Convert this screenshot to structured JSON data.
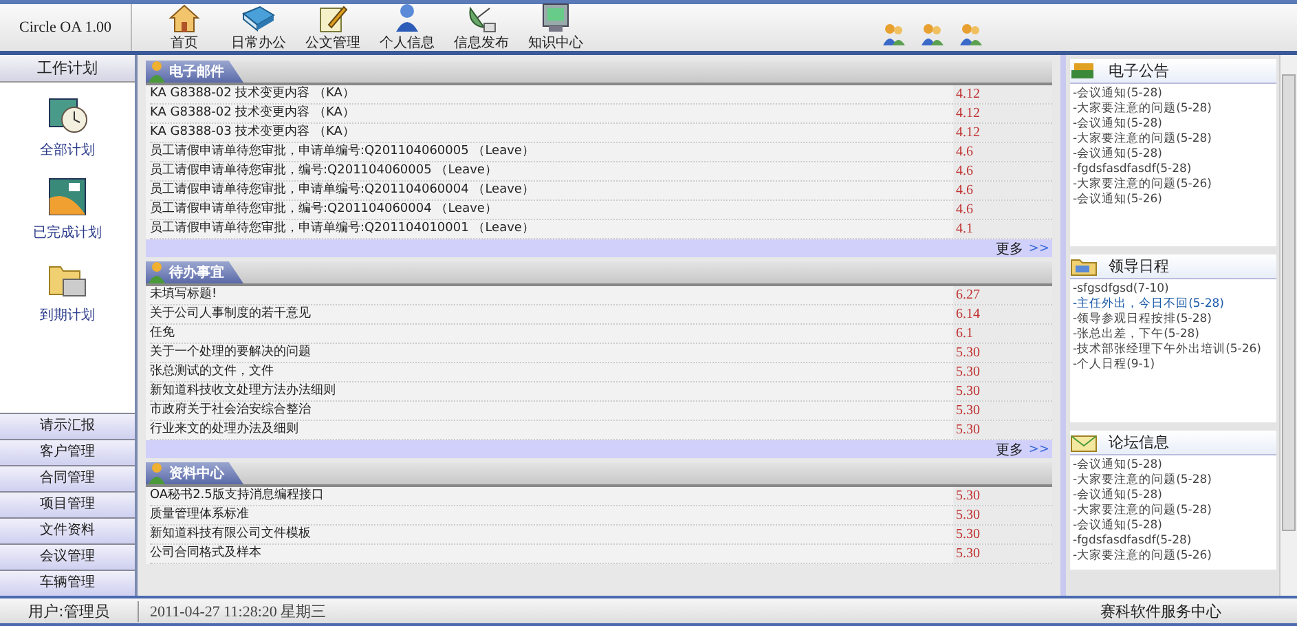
{
  "app_title": "Circle OA 1.00",
  "nav": [
    {
      "label": "首页"
    },
    {
      "label": "日常办公"
    },
    {
      "label": "公文管理"
    },
    {
      "label": "个人信息"
    },
    {
      "label": "信息发布"
    },
    {
      "label": "知识中心"
    }
  ],
  "sidebar": {
    "header": "工作计划",
    "plans": [
      {
        "label": "全部计划"
      },
      {
        "label": "已完成计划"
      },
      {
        "label": "到期计划"
      }
    ],
    "menu": [
      "请示汇报",
      "客户管理",
      "合同管理",
      "项目管理",
      "文件资料",
      "会议管理",
      "车辆管理"
    ]
  },
  "sections": [
    {
      "title": "电子邮件",
      "more": "更多",
      "more_arrow": ">>",
      "rows": [
        {
          "text": "KA G8388-02 技术变更内容 （KA）",
          "date": "4.12"
        },
        {
          "text": "KA G8388-02 技术变更内容 （KA）",
          "date": "4.12"
        },
        {
          "text": "KA G8388-03 技术变更内容 （KA）",
          "date": "4.12"
        },
        {
          "text": "员工请假申请单待您审批，申请单编号:Q201104060005 （Leave）",
          "date": "4.6"
        },
        {
          "text": "员工请假申请单待您审批，编号:Q201104060005 （Leave）",
          "date": "4.6"
        },
        {
          "text": "员工请假申请单待您审批，申请单编号:Q201104060004 （Leave）",
          "date": "4.6"
        },
        {
          "text": "员工请假申请单待您审批，编号:Q201104060004 （Leave）",
          "date": "4.6"
        },
        {
          "text": "员工请假申请单待您审批，申请单编号:Q201104010001 （Leave）",
          "date": "4.1"
        }
      ]
    },
    {
      "title": "待办事宜",
      "more": "更多",
      "more_arrow": ">>",
      "rows": [
        {
          "text": "未填写标题!",
          "date": "6.27"
        },
        {
          "text": "关于公司人事制度的若干意见",
          "date": "6.14"
        },
        {
          "text": "任免",
          "date": "6.1"
        },
        {
          "text": "关于一个处理的要解决的问题",
          "date": "5.30"
        },
        {
          "text": "张总测试的文件，文件",
          "date": "5.30"
        },
        {
          "text": "新知道科技收文处理方法办法细则",
          "date": "5.30"
        },
        {
          "text": "市政府关于社会治安综合整治",
          "date": "5.30"
        },
        {
          "text": "行业来文的处理办法及细则",
          "date": "5.30"
        }
      ]
    },
    {
      "title": "资料中心",
      "rows": [
        {
          "text": "OA秘书2.5版支持消息编程接口",
          "date": "5.30"
        },
        {
          "text": "质量管理体系标准",
          "date": "5.30"
        },
        {
          "text": "新知道科技有限公司文件模板",
          "date": "5.30"
        },
        {
          "text": "公司合同格式及样本",
          "date": "5.30"
        }
      ]
    }
  ],
  "panels": [
    {
      "title": "电子公告",
      "items": [
        {
          "text": "-会议通知(5-28)",
          "selected": false
        },
        {
          "text": "-大家要注意的问题(5-28)",
          "selected": false
        },
        {
          "text": "-会议通知(5-28)",
          "selected": false
        },
        {
          "text": "-大家要注意的问题(5-28)",
          "selected": false
        },
        {
          "text": "-会议通知(5-28)",
          "selected": false
        },
        {
          "text": "-fgdsfasdfasdf(5-28)",
          "selected": false
        },
        {
          "text": "-大家要注意的问题(5-26)",
          "selected": false
        },
        {
          "text": "-会议通知(5-26)",
          "selected": false
        }
      ]
    },
    {
      "title": "领导日程",
      "items": [
        {
          "text": "-sfgsdfgsd(7-10)",
          "selected": false
        },
        {
          "text": "-主任外出，今日不回(5-28)",
          "selected": true
        },
        {
          "text": "-领导参观日程按排(5-28)",
          "selected": false
        },
        {
          "text": "-张总出差，下午(5-28)",
          "selected": false
        },
        {
          "text": "-技术部张经理下午外出培训(5-26)",
          "selected": false
        },
        {
          "text": "-个人日程(9-1)",
          "selected": false
        }
      ]
    },
    {
      "title": "论坛信息",
      "items": [
        {
          "text": "-会议通知(5-28)",
          "selected": false
        },
        {
          "text": "-大家要注意的问题(5-28)",
          "selected": false
        },
        {
          "text": "-会议通知(5-28)",
          "selected": false
        },
        {
          "text": "-大家要注意的问题(5-28)",
          "selected": false
        },
        {
          "text": "-会议通知(5-28)",
          "selected": false
        },
        {
          "text": "-fgdsfasdfasdf(5-28)",
          "selected": false
        },
        {
          "text": "-大家要注意的问题(5-26)",
          "selected": false
        }
      ]
    }
  ],
  "status_bar": {
    "user": "用户:管理员",
    "datetime": "2011-04-27 11:28:20 星期三",
    "company": "赛科软件服务中心"
  }
}
